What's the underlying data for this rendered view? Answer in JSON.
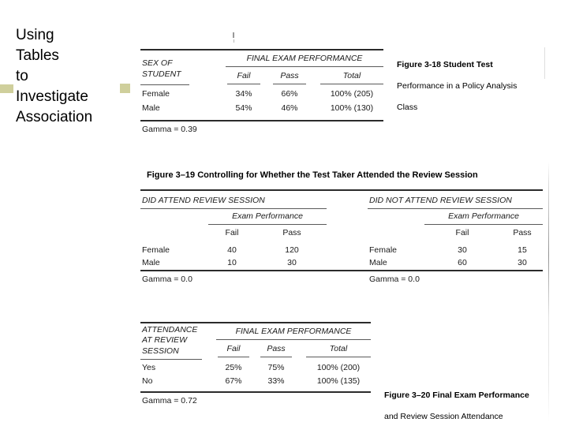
{
  "slide": {
    "title": "Using\nTables\nto\nInvestigate\nAssociation"
  },
  "colors": {
    "bullet": "#cfcf9c",
    "text": "#000000"
  },
  "figure_318": {
    "caption": "Figure  3-18  Student Test Performance in a Policy Analysis Class",
    "caption_lines": [
      "Figure  3-18  Student Test",
      "Performance in a Policy Analysis",
      "Class"
    ],
    "stub_head": [
      "SEX OF",
      "STUDENT"
    ],
    "spanner": "FINAL EXAM PERFORMANCE",
    "columns": [
      "Fail",
      "Pass",
      "Total"
    ],
    "rows": [
      {
        "label": "Female",
        "fail": "34%",
        "pass": "66%",
        "total": "100% (205)"
      },
      {
        "label": "Male",
        "fail": "54%",
        "pass": "46%",
        "total": "100% (130)"
      }
    ],
    "gamma": "Gamma = 0.39"
  },
  "figure_319": {
    "title": "Figure  3–19  Controlling for Whether the Test Taker Attended the Review Session",
    "left_panel": {
      "heading": "DID ATTEND REVIEW SESSION",
      "spanner": "Exam Performance",
      "columns": [
        "Fail",
        "Pass"
      ],
      "rows": [
        {
          "label": "Female",
          "fail": "40",
          "pass": "120"
        },
        {
          "label": "Male",
          "fail": "10",
          "pass": "30"
        }
      ],
      "gamma": "Gamma = 0.0"
    },
    "right_panel": {
      "heading": "DID NOT ATTEND REVIEW SESSION",
      "spanner": "Exam Performance",
      "columns": [
        "Fail",
        "Pass"
      ],
      "rows": [
        {
          "label": "Female",
          "fail": "30",
          "pass": "15"
        },
        {
          "label": "Male",
          "fail": "60",
          "pass": "30"
        }
      ],
      "gamma": "Gamma = 0.0"
    }
  },
  "figure_320": {
    "caption_lines": [
      "Figure  3–20  Final Exam Performance",
      "and Review Session Attendance"
    ],
    "stub_head": [
      "ATTENDANCE",
      "AT REVIEW",
      "SESSION"
    ],
    "spanner": "FINAL EXAM PERFORMANCE",
    "columns": [
      "Fail",
      "Pass",
      "Total"
    ],
    "rows": [
      {
        "label": "Yes",
        "fail": "25%",
        "pass": "75%",
        "total": "100% (200)"
      },
      {
        "label": "No",
        "fail": "67%",
        "pass": "33%",
        "total": "100% (135)"
      }
    ],
    "gamma": "Gamma = 0.72"
  }
}
